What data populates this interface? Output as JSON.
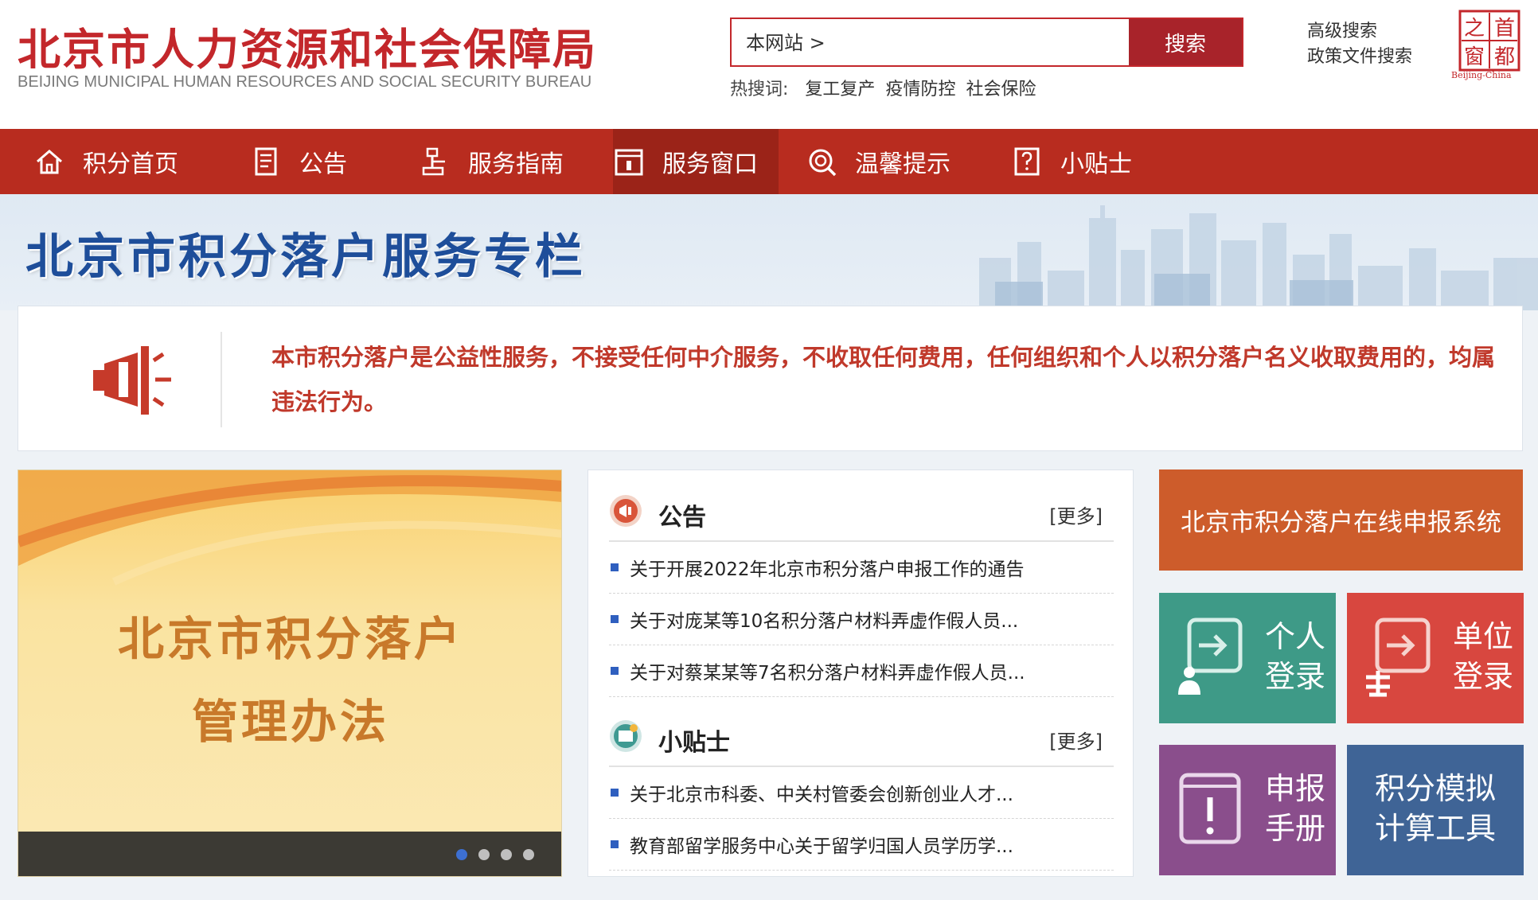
{
  "header": {
    "title_cn": "北京市人力资源和社会保障局",
    "title_en": "BEIJING MUNICIPAL HUMAN RESOURCES AND SOCIAL SECURITY BUREAU",
    "search": {
      "scope_label": "本网站 >",
      "value": "",
      "button_label": "搜索"
    },
    "links": {
      "advanced_search": "高级搜索",
      "policy_search": "政策文件搜索"
    },
    "hot": {
      "label": "热搜词:",
      "items": [
        "复工复产",
        "疫情防控",
        "社会保险"
      ]
    },
    "seal": {
      "chars": [
        "之",
        "首",
        "窗",
        "都"
      ],
      "subtitle": "Beijing-China"
    }
  },
  "nav": {
    "items": [
      {
        "label": "积分首页",
        "icon": "home-icon"
      },
      {
        "label": "公告",
        "icon": "document-icon"
      },
      {
        "label": "服务指南",
        "icon": "guide-icon"
      },
      {
        "label": "服务窗口",
        "icon": "window-icon",
        "active": true
      },
      {
        "label": "温馨提示",
        "icon": "reminder-icon"
      },
      {
        "label": "小贴士",
        "icon": "tip-icon"
      }
    ]
  },
  "banner": {
    "title": "北京市积分落户服务专栏"
  },
  "notice": {
    "icon": "megaphone-icon",
    "text": "本市积分落户是公益性服务，不接受任何中介服务，不收取任何费用，任何组织和个人以积分落户名义收取费用的，均属违法行为。"
  },
  "slider": {
    "title_line1": "北京市积分落户",
    "title_line2": "管理办法",
    "active_dot": 1,
    "dot_count": 4
  },
  "news": {
    "announcements": {
      "title": "公告",
      "more": "[更多]",
      "items": [
        "关于开展2022年北京市积分落户申报工作的通告",
        "关于对庞某等10名积分落户材料弄虚作假人员...",
        "关于对蔡某某等7名积分落户材料弄虚作假人员..."
      ]
    },
    "tips": {
      "title": "小贴士",
      "more": "[更多]",
      "items": [
        "关于北京市科委、中关村管委会创新创业人才...",
        "教育部留学服务中心关于留学归国人员学历学..."
      ]
    }
  },
  "tiles": {
    "online_system": "北京市积分落户在线申报系统",
    "personal_login": "个人登录",
    "unit_login": "单位登录",
    "manual": "申报手册",
    "calculator_line1": "积分模拟",
    "calculator_line2": "计算工具"
  },
  "colors": {
    "brand_red": "#c3272b",
    "nav_red": "#b82c1f",
    "nav_active": "#9b2318",
    "banner_blue": "#1e4e9a",
    "tile_orange": "#cd5c2b",
    "tile_green": "#3e9a87",
    "tile_red": "#d8473f",
    "tile_purple": "#8a4e8c",
    "tile_blue": "#3f6496"
  }
}
